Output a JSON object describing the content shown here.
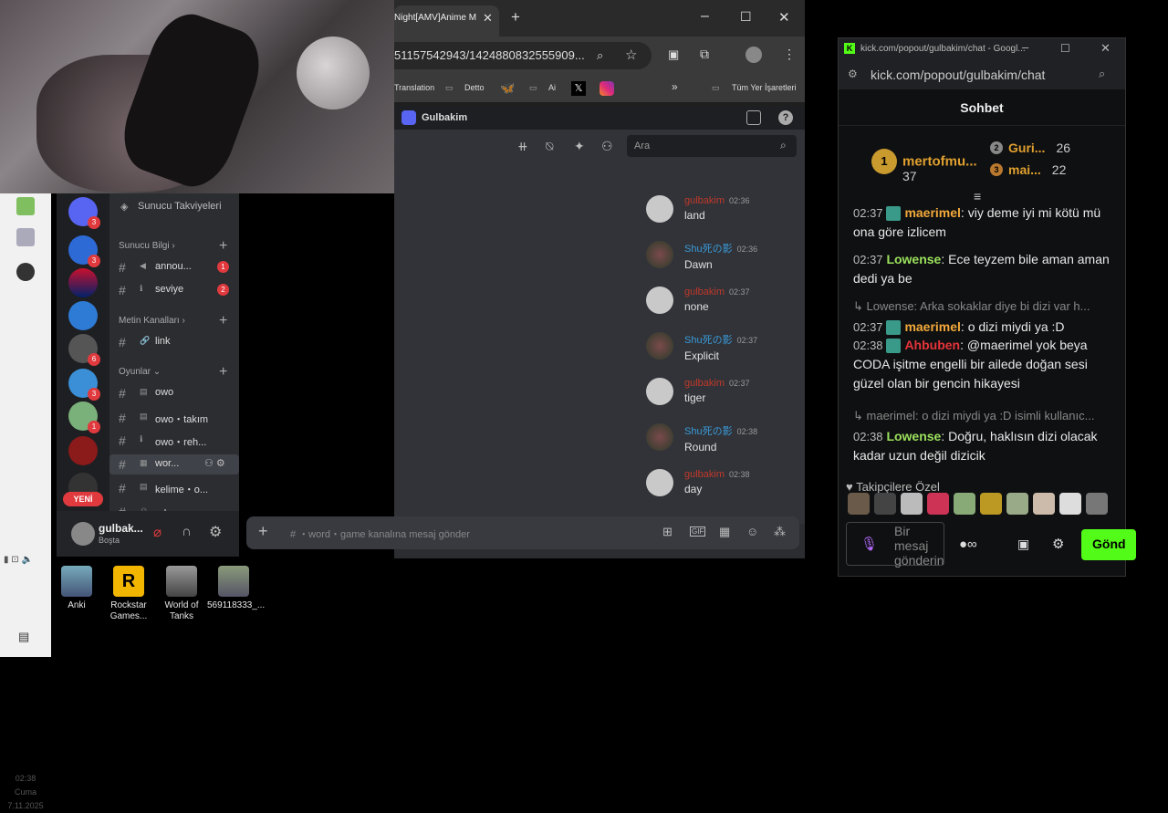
{
  "browser": {
    "tab_title": "Night[AMV]Anime M",
    "address": "51157542943/1424880832555909...",
    "bookmarks": [
      "Translation",
      "Detto",
      "Ai",
      "Tüm Yer İşaretleri"
    ]
  },
  "discord": {
    "server_name": "Gulbakim",
    "search_placeholder": "Ara",
    "boost_label": "Sunucu Takviyeleri",
    "categories": {
      "info": "Sunucu Bilgi",
      "text": "Metin Kanalları",
      "games": "Oyunlar"
    },
    "channels": [
      {
        "label": "annou...",
        "badge": "1"
      },
      {
        "label": "seviye",
        "badge": "2"
      },
      {
        "label": "link",
        "badge": ""
      },
      {
        "label": "owo",
        "badge": ""
      },
      {
        "label": "owo・takım",
        "badge": ""
      },
      {
        "label": "owo・reh...",
        "badge": ""
      },
      {
        "label": "wor...",
        "badge": ""
      },
      {
        "label": "kelime・o...",
        "badge": ""
      },
      {
        "label": "adam・as...",
        "badge": ""
      }
    ],
    "server_badges": [
      "3",
      "3",
      "6",
      "3",
      "1"
    ],
    "new_label": "YENİ",
    "messages": [
      {
        "author": "gulbakim",
        "time": "02:36",
        "text": "land"
      },
      {
        "author": "Shu死の影",
        "time": "02:36",
        "text": "Dawn"
      },
      {
        "author": "gulbakim",
        "time": "02:37",
        "text": "none"
      },
      {
        "author": "Shu死の影",
        "time": "02:37",
        "text": "Explicit"
      },
      {
        "author": "gulbakim",
        "time": "02:37",
        "text": "tiger"
      },
      {
        "author": "Shu死の影",
        "time": "02:38",
        "text": "Round"
      },
      {
        "author": "gulbakim",
        "time": "02:38",
        "text": "day"
      }
    ],
    "user": {
      "name": "gulbak...",
      "status": "Boşta"
    },
    "composer_placeholder": "・word・game kanalına mesaj gönder"
  },
  "desktop": {
    "icons": [
      "Anki",
      "Rockstar Games...",
      "World of Tanks",
      "569118333_..."
    ]
  },
  "taskbar": {
    "time": "02:38",
    "day": "Cuma",
    "date": "7.11.2025"
  },
  "kick": {
    "window_title": "kick.com/popout/gulbakim/chat - Googl...",
    "address": "kick.com/popout/gulbakim/chat",
    "heading": "Sohbet",
    "leaderboard": [
      {
        "rank": "1",
        "name": "mertofmu...",
        "count": "37"
      },
      {
        "rank": "2",
        "name": "Guri...",
        "count": "26"
      },
      {
        "rank": "3",
        "name": "mai...",
        "count": "22"
      }
    ],
    "messages": [
      {
        "time": "02:37",
        "author": "maerimel",
        "text": "viy deme iyi mi kötü mü ona göre izlicem"
      },
      {
        "time": "02:37",
        "author": "Lowense",
        "text": "Ece teyzem bile aman aman dedi ya be"
      },
      {
        "time": "02:37",
        "author": "maerimel",
        "text": "o dizi miydi ya :D",
        "reply": "Lowense: Arka sokaklar diye bi dizi var h..."
      },
      {
        "time": "02:38",
        "author": "Ahbuben",
        "text": "@maerimel yok beya CODA işitme engelli bir ailede doğan sesi güzel olan bir gencin hikayesi"
      },
      {
        "time": "02:38",
        "author": "Lowense",
        "text": "Doğru, haklısın dizi olacak kadar uzun değil dizicik",
        "reply": "maerimel: o dizi miydi ya :D isimli kullanıc..."
      }
    ],
    "followers_only": "Takipçilere Özel",
    "input_placeholder": "Bir mesaj gönderin",
    "send_label": "Gönd"
  }
}
